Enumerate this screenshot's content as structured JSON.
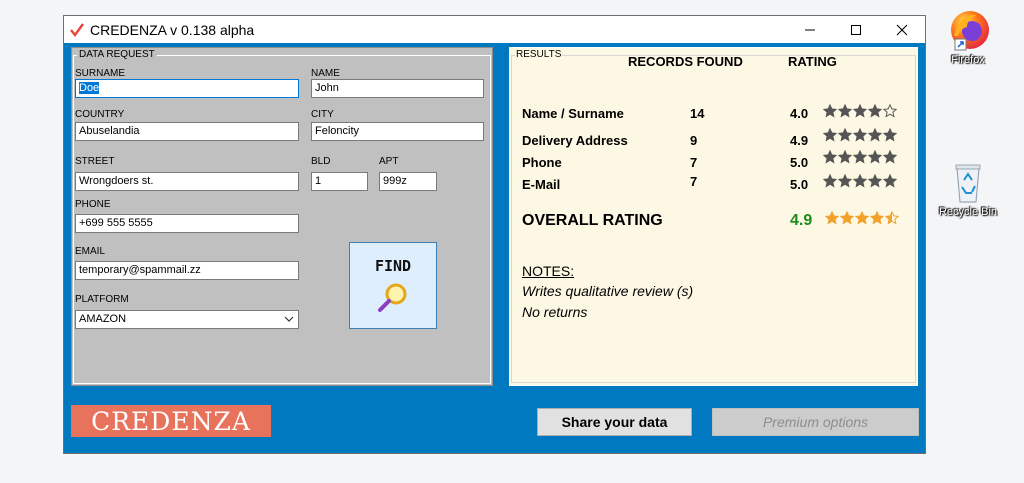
{
  "window": {
    "title": "CREDENZA v 0.138 alpha",
    "accent_color": "#0079c1"
  },
  "data_request": {
    "group_label": "DATA REQUEST",
    "surname_label": "SURNAME",
    "surname_value": "Doe",
    "name_label": "NAME",
    "name_value": "John",
    "country_label": "COUNTRY",
    "country_value": "Abuselandia",
    "city_label": "CITY",
    "city_value": "Feloncity",
    "street_label": "STREET",
    "street_value": "Wrongdoers st.",
    "bld_label": "BLD",
    "bld_value": "1",
    "apt_label": "APT",
    "apt_value": "999z",
    "phone_label": "PHONE",
    "phone_value": "+699 555 5555",
    "email_label": "EMAIL",
    "email_value": "temporary@spammail.zz",
    "platform_label": "PLATFORM",
    "platform_value": "AMAZON",
    "find_label": "FIND"
  },
  "results": {
    "group_label": "RESULTS",
    "col_records": "RECORDS FOUND",
    "col_rating": "RATING",
    "rows": [
      {
        "label": "Name / Surname",
        "count": "14",
        "rating": "4.0",
        "stars": 4
      },
      {
        "label": "Delivery Address",
        "count": "9",
        "rating": "4.9",
        "stars": 5
      },
      {
        "label": "Phone",
        "count": "7",
        "rating": "5.0",
        "stars": 5
      },
      {
        "label": "E-Mail",
        "count": "7",
        "rating": "5.0",
        "stars": 5
      }
    ],
    "overall_label": "OVERALL RATING",
    "overall_value": "4.9",
    "overall_stars": 4.5,
    "overall_color": "#1a8c1a",
    "notes_heading": "NOTES:",
    "notes": [
      "Writes qualitative review (s)",
      "No returns"
    ]
  },
  "bottom": {
    "logo_text": "CREDENZA",
    "logo_color": "#e8735c",
    "share_label": "Share your data",
    "premium_label": "Premium options"
  },
  "desktop": {
    "firefox_label": "Firefox",
    "recycle_label": "Recycle Bin"
  }
}
